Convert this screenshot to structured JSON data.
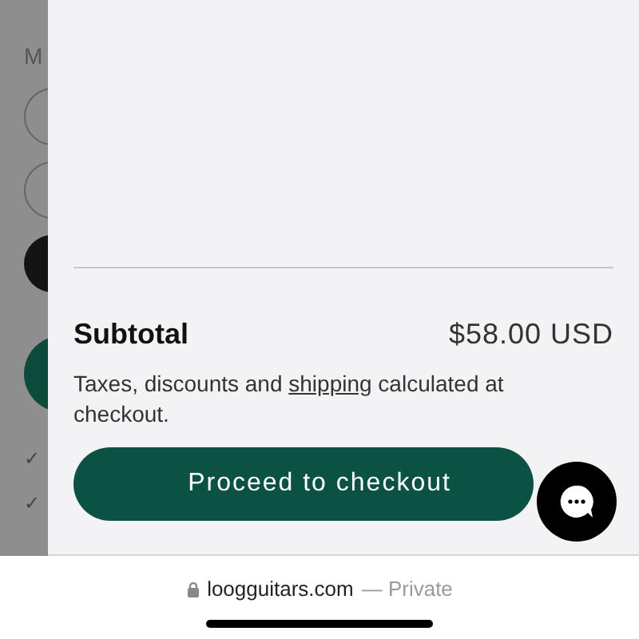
{
  "background": {
    "label": "M",
    "options": [
      {
        "selected": false
      },
      {
        "selected": false
      },
      {
        "selected": true
      }
    ],
    "checks": [
      "✓",
      "✓"
    ]
  },
  "cart": {
    "subtotal_label": "Subtotal",
    "subtotal_value": "$58.00 USD",
    "note_before": "Taxes, discounts and ",
    "note_link": "shipping",
    "note_after": " calculated at checkout.",
    "checkout_button": "Proceed to checkout"
  },
  "browser": {
    "domain": "loogguitars.com",
    "privacy": "— Private"
  }
}
